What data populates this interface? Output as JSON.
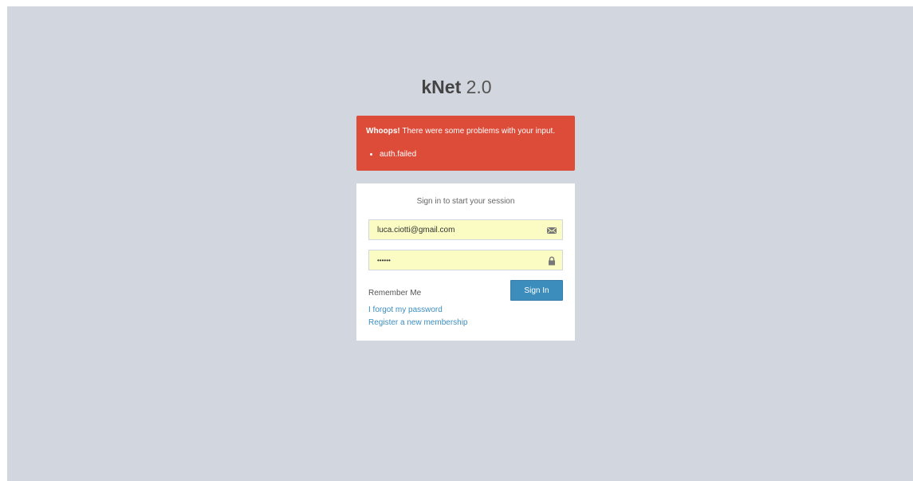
{
  "logo": {
    "brand": "kNet",
    "version": "2.0"
  },
  "alert": {
    "title": "Whoops!",
    "message": " There were some problems with your input.",
    "errors": [
      "auth.failed"
    ]
  },
  "login": {
    "message": "Sign in to start your session",
    "email_value": "luca.ciotti@gmail.com",
    "password_value": "••••••",
    "remember_label": "Remember Me",
    "signin_label": "Sign In",
    "forgot_link": "I forgot my password",
    "register_link": "Register a new membership"
  },
  "icons": {
    "email": "envelope-icon",
    "password": "lock-icon"
  },
  "colors": {
    "background": "#d2d6de",
    "alert": "#dd4b39",
    "primary": "#3c8dbc",
    "autofill": "#fafcc3"
  }
}
